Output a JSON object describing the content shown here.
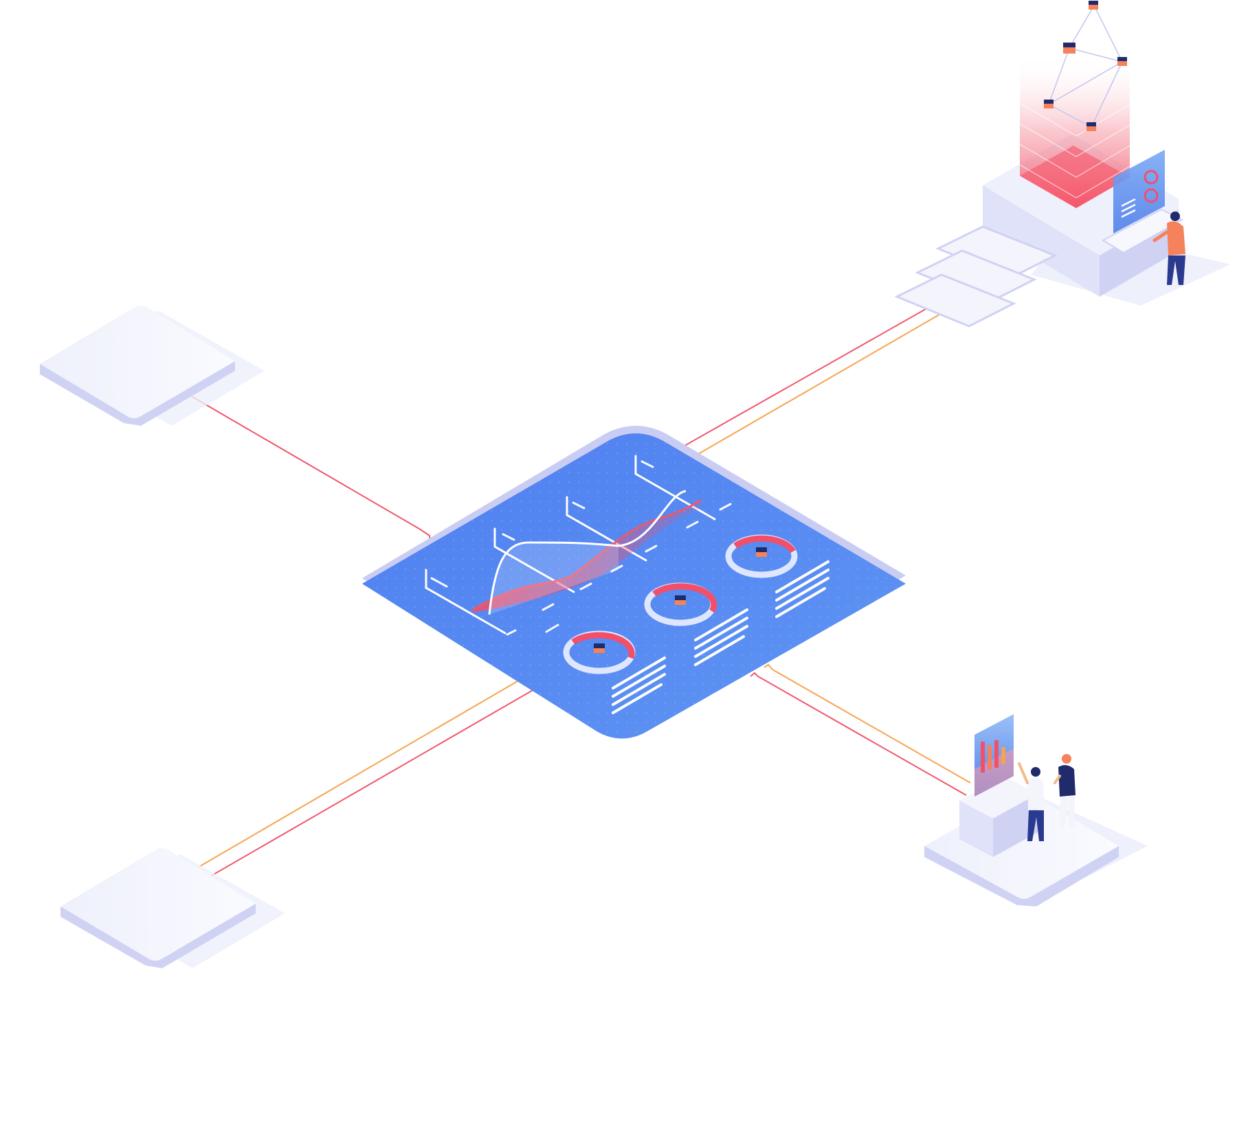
{
  "illustration": {
    "colors": {
      "background": "#ffffff",
      "platform_blue": "#5b8bf0",
      "platform_blue_dark": "#4a78e6",
      "platform_rim": "#c9cdf3",
      "tile_top": "#f3f4fc",
      "tile_side": "#cfd2f3",
      "line_red": "#f0576b",
      "line_orange": "#f6a350",
      "accent_pink": "#f5707e",
      "accent_navy": "#1f2b6b",
      "cube_orange": "#f5825a"
    },
    "icons": [
      "empty-tile-icon",
      "network-cube-icon",
      "person-icon",
      "bar-chart-panel-icon",
      "donut-chart-icon",
      "wave-chart-icon"
    ]
  }
}
